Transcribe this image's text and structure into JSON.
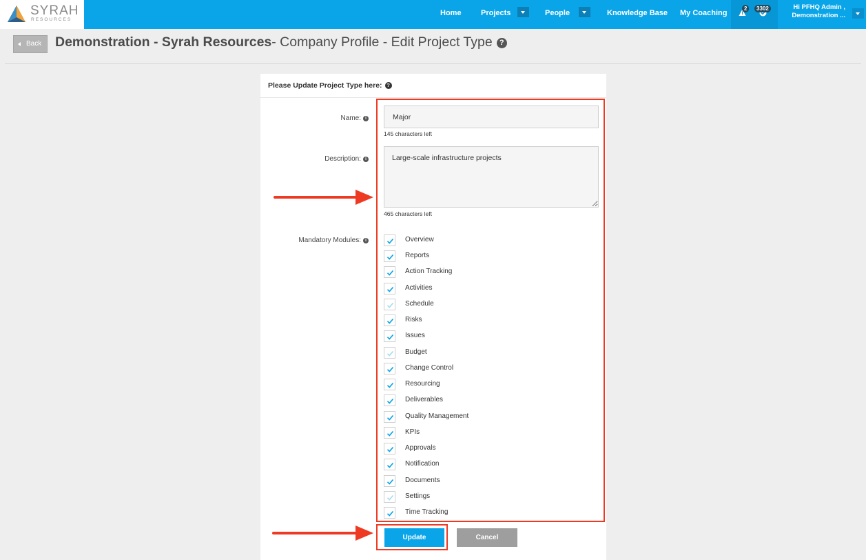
{
  "brand": {
    "name": "SYRAH",
    "sub": "RESOURCES"
  },
  "nav": {
    "home": "Home",
    "projects": "Projects",
    "people": "People",
    "knowledge_base": "Knowledge Base",
    "my_coaching": "My Coaching",
    "alerts_count": "2",
    "tasks_count": "3302",
    "user_line1": "Hi PFHQ Admin ,",
    "user_line2": "Demonstration ..."
  },
  "header": {
    "back_label": "Back",
    "title_strong": "Demonstration - Syrah Resources",
    "title_rest": "- Company Profile - Edit Project Type",
    "help": "?"
  },
  "panel": {
    "heading": "Please Update Project Type here:",
    "help": "?"
  },
  "form": {
    "name_label": "Name:",
    "name_value": "Major",
    "name_hint": "145 characters left",
    "description_label": "Description:",
    "description_value": "Large-scale infrastructure projects",
    "description_hint": "465 characters left",
    "modules_label": "Mandatory Modules:",
    "info": "i"
  },
  "modules": [
    {
      "label": "Overview",
      "checked": true,
      "dim": false
    },
    {
      "label": "Reports",
      "checked": true,
      "dim": false
    },
    {
      "label": "Action Tracking",
      "checked": true,
      "dim": false
    },
    {
      "label": "Activities",
      "checked": true,
      "dim": false
    },
    {
      "label": "Schedule",
      "checked": true,
      "dim": true
    },
    {
      "label": "Risks",
      "checked": true,
      "dim": false
    },
    {
      "label": "Issues",
      "checked": true,
      "dim": false
    },
    {
      "label": "Budget",
      "checked": true,
      "dim": true
    },
    {
      "label": "Change Control",
      "checked": true,
      "dim": false
    },
    {
      "label": "Resourcing",
      "checked": true,
      "dim": false
    },
    {
      "label": "Deliverables",
      "checked": true,
      "dim": false
    },
    {
      "label": "Quality Management",
      "checked": true,
      "dim": false
    },
    {
      "label": "KPIs",
      "checked": true,
      "dim": false
    },
    {
      "label": "Approvals",
      "checked": true,
      "dim": false
    },
    {
      "label": "Notification",
      "checked": true,
      "dim": false
    },
    {
      "label": "Documents",
      "checked": true,
      "dim": false
    },
    {
      "label": "Settings",
      "checked": true,
      "dim": true
    },
    {
      "label": "Time Tracking",
      "checked": true,
      "dim": false
    }
  ],
  "buttons": {
    "update": "Update",
    "cancel": "Cancel"
  },
  "colors": {
    "primary": "#0aa5e8",
    "annotation": "#ee3a23",
    "cancel": "#9e9e9e"
  }
}
